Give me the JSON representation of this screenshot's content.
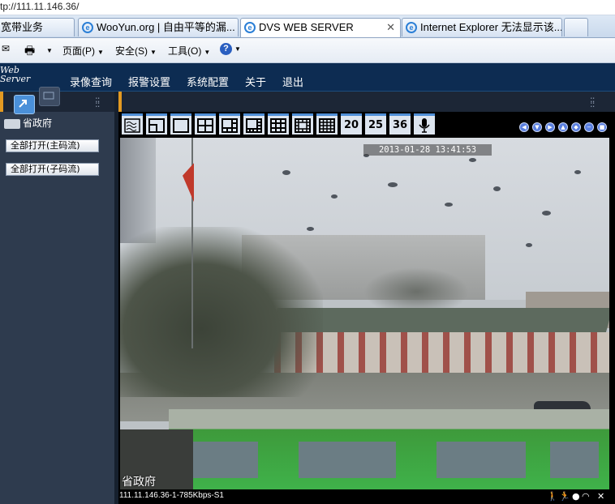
{
  "browser": {
    "address": "tp://111.11.146.36/",
    "tabs": [
      {
        "label": "宽带业务",
        "active": false
      },
      {
        "label": "WooYun.org | 自由平等的漏...",
        "active": false
      },
      {
        "label": "DVS WEB SERVER",
        "active": true
      },
      {
        "label": "Internet Explorer 无法显示该...",
        "active": false
      }
    ],
    "commands": {
      "page": "页面(P)",
      "safety": "安全(S)",
      "tools": "工具(O)"
    }
  },
  "app": {
    "logo_top": "Web",
    "logo_bottom": "Server",
    "nav": [
      "录像查询",
      "报警设置",
      "系统配置",
      "关于",
      "退出"
    ]
  },
  "left_panel": {
    "tree_item": "省政府",
    "buttons": [
      "全部打开(主码流)",
      "全部打开(子码流)"
    ]
  },
  "toolbar": {
    "layouts": [
      "wave",
      "1x1-inset",
      "1",
      "4",
      "6",
      "8",
      "9",
      "13",
      "16",
      "20",
      "25",
      "36",
      "mic"
    ],
    "number_labels": [
      "20",
      "25",
      "36"
    ]
  },
  "video": {
    "timestamp": "2013-01-28 13:41:53",
    "channel_name": "省政府",
    "status": "111.11.146.36-1-785Kbps-S1"
  },
  "colors": {
    "nav_bg": "#0d2c52",
    "panel_bg": "#2e3b4e",
    "accent": "#e39a22",
    "toolbar_accent": "#4f8fd7"
  }
}
